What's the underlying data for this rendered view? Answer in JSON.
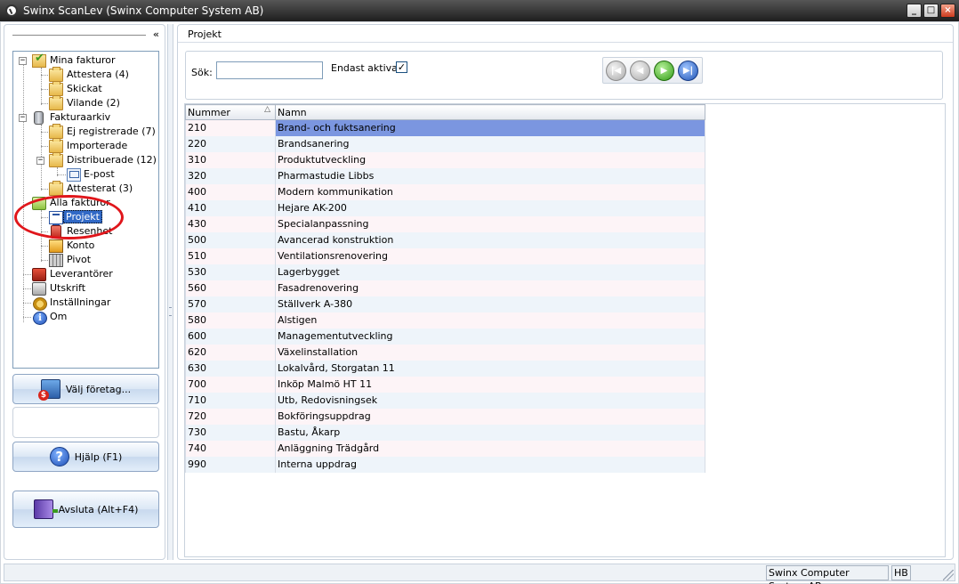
{
  "window": {
    "title": "Swinx ScanLev (Swinx Computer System AB)",
    "min_label": "_",
    "max_label": "□",
    "close_label": "×"
  },
  "sidebar": {
    "collapse_label": "«",
    "tree": {
      "mina_fakturor": "Mina fakturor",
      "attestera": "Attestera (4)",
      "skickat": "Skickat",
      "vilande": "Vilande (2)",
      "fakturaarkiv": "Fakturaarkiv",
      "ej_registrerade": "Ej registrerade (7)",
      "importerade": "Importerade",
      "distribuerade": "Distribuerade (12)",
      "epost": "E-post",
      "attesterat": "Attesterat (3)",
      "alla_fakturor": "Alla fakturor",
      "projekt": "Projekt",
      "resenhet": "Resenhet",
      "konto": "Konto",
      "pivot": "Pivot",
      "leverantorer": "Leverantörer",
      "utskrift": "Utskrift",
      "installningar": "Inställningar",
      "om": "Om",
      "expand_minus": "−",
      "info_glyph": "i"
    },
    "buttons": {
      "valj_foretag": "Välj företag...",
      "hjalp": "Hjälp (F1)",
      "avsluta": "Avsluta (Alt+F4)",
      "help_glyph": "?"
    }
  },
  "main": {
    "title": "Projekt",
    "search": {
      "label": "Sök:",
      "value": "",
      "placeholder": "",
      "only_active_label": "Endast aktiva",
      "only_active_checked": "✓"
    },
    "nav": {
      "first": "|◀",
      "prev": "◀",
      "next": "▶",
      "last": "▶|"
    },
    "table": {
      "columns": [
        "Nummer",
        "Namn"
      ],
      "sort_glyph": "△",
      "rows": [
        {
          "num": "210",
          "name": "Brand- och fuktsanering"
        },
        {
          "num": "220",
          "name": "Brandsanering"
        },
        {
          "num": "310",
          "name": "Produktutveckling"
        },
        {
          "num": "320",
          "name": "Pharmastudie Libbs"
        },
        {
          "num": "400",
          "name": "Modern kommunikation"
        },
        {
          "num": "410",
          "name": "Hejare AK-200"
        },
        {
          "num": "430",
          "name": "Specialanpassning"
        },
        {
          "num": "500",
          "name": "Avancerad konstruktion"
        },
        {
          "num": "510",
          "name": "Ventilationsrenovering"
        },
        {
          "num": "530",
          "name": "Lagerbygget"
        },
        {
          "num": "560",
          "name": "Fasadrenovering"
        },
        {
          "num": "570",
          "name": "Ställverk A-380"
        },
        {
          "num": "580",
          "name": "Alstigen"
        },
        {
          "num": "600",
          "name": "Managementutveckling"
        },
        {
          "num": "620",
          "name": "Växelinstallation"
        },
        {
          "num": "630",
          "name": "Lokalvård, Storgatan 11"
        },
        {
          "num": "700",
          "name": "Inköp Malmö HT 11"
        },
        {
          "num": "710",
          "name": "Utb, Redovisningsek"
        },
        {
          "num": "720",
          "name": "Bokföringsuppdrag"
        },
        {
          "num": "730",
          "name": "Bastu, Åkarp"
        },
        {
          "num": "740",
          "name": "Anläggning Trädgård"
        },
        {
          "num": "990",
          "name": "Interna uppdrag"
        }
      ]
    }
  },
  "statusbar": {
    "company": "Swinx Computer System AB",
    "user": "HB"
  },
  "colors": {
    "selection": "#3169c6",
    "row_selected": "#7b96e0",
    "annotation": "#e0161b"
  }
}
